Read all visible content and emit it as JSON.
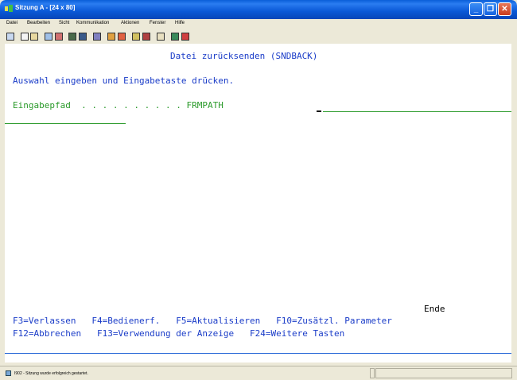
{
  "window": {
    "title": "Sitzung A - [24 x 80]",
    "minimize_label": "_",
    "restore_label": "❐",
    "close_label": "✕"
  },
  "menubar": {
    "items": [
      "Datei",
      "Bearbeiten",
      "Sicht",
      "Kommunikation",
      "Aktionen",
      "Fenster",
      "Hilfe"
    ]
  },
  "toolbar": {
    "icons": [
      "print-screen-icon",
      "copy-icon",
      "paste-icon",
      "send-icon",
      "receive-icon",
      "display-icon",
      "macro-icon",
      "chart-icon",
      "transfer-up-icon",
      "transfer-down-icon",
      "record-icon",
      "playback-icon",
      "host-icon",
      "stop-icon",
      "connect-icon"
    ]
  },
  "terminal": {
    "screen_title": "Datei zurücksenden (SNDBACK)",
    "instruction": "Auswahl eingeben und Eingabetaste drücken.",
    "field_label": "Eingabepfad  . . . . . . . . . . FRMPATH",
    "field_value": "",
    "more_indicator": "Ende",
    "fkeys_row1": "F3=Verlassen   F4=Bedienerf.   F5=Aktualisieren   F10=Zusätzl. Parameter",
    "fkeys_row2": "F12=Abbrechen   F13=Verwendung der Anzeige   F24=Weitere Tasten"
  },
  "statusbar": {
    "message": "I902 - Sitzung wurde erfolgreich gestartet."
  },
  "colors": {
    "title_blue": "#0a58d6",
    "terminal_blue": "#1a3cc8",
    "terminal_green": "#2a9a2a"
  }
}
